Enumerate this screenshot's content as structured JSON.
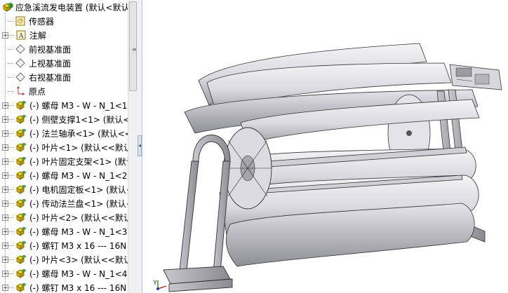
{
  "feature_tree": {
    "root_label": "应急溪流发电装置 (默认<默认",
    "items": [
      {
        "label": "传感器",
        "icon": "sensor-icon",
        "expandable": false
      },
      {
        "label": "注解",
        "icon": "annotation-icon",
        "expandable": true
      },
      {
        "label": "前视基准面",
        "icon": "plane-icon",
        "expandable": false
      },
      {
        "label": "上视基准面",
        "icon": "plane-icon",
        "expandable": false
      },
      {
        "label": "右视基准面",
        "icon": "plane-icon",
        "expandable": false
      },
      {
        "label": "原点",
        "icon": "origin-icon",
        "expandable": false
      },
      {
        "label": "(-) 螺母 M3 - W - N_1<1",
        "icon": "part-icon",
        "expandable": true
      },
      {
        "label": "(-) 侧壁支撑1<1> (默认<",
        "icon": "part-icon",
        "expandable": true
      },
      {
        "label": "(-) 法兰轴承<1> (默认<<",
        "icon": "part-icon",
        "expandable": true
      },
      {
        "label": "(-) 叶片<1> (默认<<默认",
        "icon": "part-icon",
        "expandable": true
      },
      {
        "label": "(-) 叶片固定支架<1> (默认",
        "icon": "part-icon",
        "expandable": true
      },
      {
        "label": "(-) 螺母 M3 - W - N_1<2",
        "icon": "part-icon",
        "expandable": true
      },
      {
        "label": "(-) 电机固定板<1> (默认<",
        "icon": "part-icon",
        "expandable": true
      },
      {
        "label": "(-) 传动法兰盘<1> (默认<",
        "icon": "part-icon",
        "expandable": true
      },
      {
        "label": "(-) 叶片<2> (默认<<默认",
        "icon": "part-icon",
        "expandable": true
      },
      {
        "label": "(-) 螺母 M3 - W - N_1<3",
        "icon": "part-icon",
        "expandable": true
      },
      {
        "label": "(-) 螺钉 M3 x 16 --- 16N",
        "icon": "part-icon",
        "expandable": true
      },
      {
        "label": "(-) 叶片<3> (默认<<默认",
        "icon": "part-icon",
        "expandable": true
      },
      {
        "label": "(-) 螺母 M3 - W - N_1<4",
        "icon": "part-icon",
        "expandable": true
      },
      {
        "label": "(-) 螺钉 M3 x 16 --- 16N",
        "icon": "part-icon",
        "expandable": true
      }
    ]
  },
  "scrollbar": {
    "grip": "≡"
  },
  "splitter": {
    "collapse_glyph": "◂"
  },
  "triad": {
    "y_label": "Y"
  },
  "colors": {
    "accent_part_yellow": "#e8c700",
    "accent_part_green": "#3aa63a",
    "tree_line": "#a0a0a0"
  }
}
